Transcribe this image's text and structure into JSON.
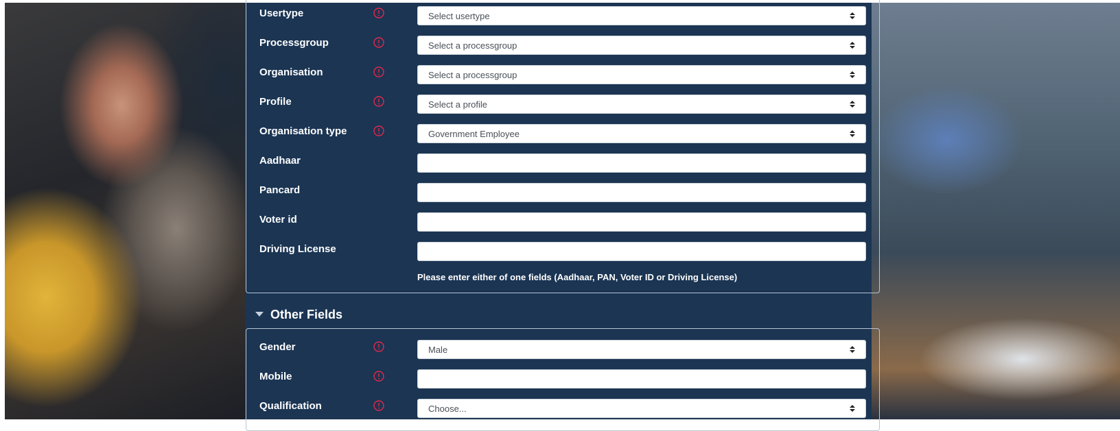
{
  "identity_section": {
    "fields": [
      {
        "id": "usertype",
        "label": "Usertype",
        "required": true,
        "type": "select",
        "value": "Select usertype"
      },
      {
        "id": "processgroup",
        "label": "Processgroup",
        "required": true,
        "type": "select",
        "value": "Select a processgroup"
      },
      {
        "id": "organisation",
        "label": "Organisation",
        "required": true,
        "type": "select",
        "value": "Select a processgroup"
      },
      {
        "id": "profile",
        "label": "Profile",
        "required": true,
        "type": "select",
        "value": "Select a profile"
      },
      {
        "id": "organisation-type",
        "label": "Organisation type",
        "required": true,
        "type": "select",
        "value": "Government Employee"
      },
      {
        "id": "aadhaar",
        "label": "Aadhaar",
        "required": false,
        "type": "text",
        "value": ""
      },
      {
        "id": "pancard",
        "label": "Pancard",
        "required": false,
        "type": "text",
        "value": ""
      },
      {
        "id": "voter-id",
        "label": "Voter id",
        "required": false,
        "type": "text",
        "value": ""
      },
      {
        "id": "driving-license",
        "label": "Driving License",
        "required": false,
        "type": "text",
        "value": ""
      }
    ],
    "note": "Please enter either of one fields (Aadhaar, PAN, Voter ID or Driving License)"
  },
  "other_section": {
    "title": "Other Fields",
    "fields": [
      {
        "id": "gender",
        "label": "Gender",
        "required": true,
        "type": "select",
        "value": "Male"
      },
      {
        "id": "mobile",
        "label": "Mobile",
        "required": true,
        "type": "text",
        "value": ""
      },
      {
        "id": "qualification",
        "label": "Qualification",
        "required": true,
        "type": "select",
        "value": "Choose..."
      }
    ]
  },
  "colors": {
    "panel_bg": "#1b3553",
    "required_icon": "#e0294a",
    "label_text": "#ffffff"
  },
  "icons": {
    "required": "exclamation-circle-icon",
    "select": "sort-arrows-icon",
    "section_toggle": "caret-down-icon"
  }
}
